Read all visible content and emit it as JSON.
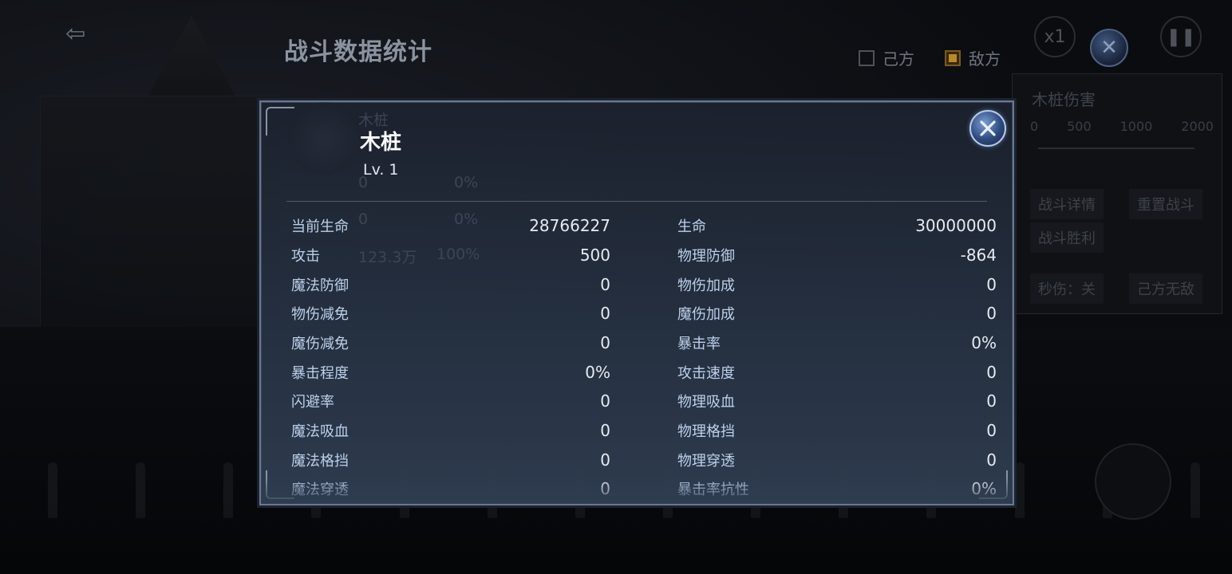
{
  "background": {
    "title": "战斗数据统计",
    "filters": [
      {
        "label": "己方",
        "checked": false
      },
      {
        "label": "敌方",
        "checked": true
      }
    ],
    "speed": "x1",
    "side_panel": {
      "title": "木桩伤害",
      "scale": [
        "0",
        "500",
        "1000",
        "2000"
      ],
      "buttons": [
        "战斗详情",
        "重置战斗",
        "战斗胜利",
        "秒伤：关",
        "己方无敌"
      ]
    },
    "ghost_stats": [
      {
        "a": "0",
        "b": "0%"
      },
      {
        "a": "0",
        "b": "0%"
      },
      {
        "a": "123.3万",
        "b": "100%"
      }
    ]
  },
  "modal": {
    "name": "木桩",
    "level": "Lv. 1",
    "ghost_label": "木桩",
    "stats": [
      {
        "left": {
          "label": "当前生命",
          "value": "28766227"
        },
        "right": {
          "label": "生命",
          "value": "30000000"
        }
      },
      {
        "left": {
          "label": "攻击",
          "value": "500"
        },
        "right": {
          "label": "物理防御",
          "value": "-864"
        }
      },
      {
        "left": {
          "label": "魔法防御",
          "value": "0"
        },
        "right": {
          "label": "物伤加成",
          "value": "0"
        }
      },
      {
        "left": {
          "label": "物伤减免",
          "value": "0"
        },
        "right": {
          "label": "魔伤加成",
          "value": "0"
        }
      },
      {
        "left": {
          "label": "魔伤减免",
          "value": "0"
        },
        "right": {
          "label": "暴击率",
          "value": "0%"
        }
      },
      {
        "left": {
          "label": "暴击程度",
          "value": "0%"
        },
        "right": {
          "label": "攻击速度",
          "value": "0"
        }
      },
      {
        "left": {
          "label": "闪避率",
          "value": "0"
        },
        "right": {
          "label": "物理吸血",
          "value": "0"
        }
      },
      {
        "left": {
          "label": "魔法吸血",
          "value": "0"
        },
        "right": {
          "label": "物理格挡",
          "value": "0"
        }
      },
      {
        "left": {
          "label": "魔法格挡",
          "value": "0"
        },
        "right": {
          "label": "物理穿透",
          "value": "0"
        }
      },
      {
        "left": {
          "label": "魔法穿透",
          "value": "0"
        },
        "right": {
          "label": "暴击率抗性",
          "value": "0%"
        }
      }
    ]
  },
  "icons": {
    "exit": "exit-icon",
    "close": "close-icon",
    "pause": "pause-icon",
    "emblem": "emblem-icon"
  },
  "colors": {
    "modal_border": "#6a7890",
    "label": "#bcd0ea",
    "value": "#e6ebf2",
    "close_button": "#2d4a7e"
  }
}
